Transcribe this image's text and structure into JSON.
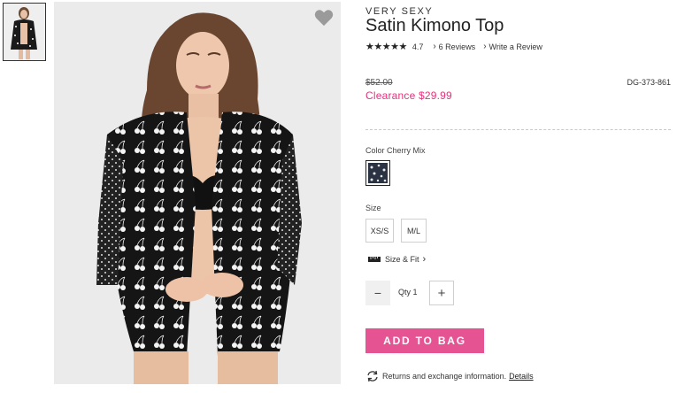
{
  "product": {
    "brand": "VERY SEXY",
    "title": "Satin Kimono Top",
    "rating": {
      "stars_text": "★★★★★",
      "value": "4.7",
      "reviews_label": "6 Reviews",
      "write_review_label": "Write a Review"
    },
    "price": {
      "original": "$52.00",
      "clearance": "Clearance $29.99"
    },
    "sku": "DG-373-861"
  },
  "options": {
    "color_label": "Color Cherry Mix",
    "size_label": "Size",
    "sizes": [
      "XS/S",
      "M/L"
    ],
    "size_fit_label": "Size & Fit"
  },
  "quantity": {
    "minus_symbol": "−",
    "label": "Qty 1",
    "plus_symbol": "+"
  },
  "actions": {
    "add_to_bag_label": "ADD TO BAG"
  },
  "returns": {
    "text": "Returns and exchange information.",
    "details_label": "Details"
  },
  "icons": {
    "wishlist": "heart-icon",
    "chevron": "chevron-right-icon",
    "ruler": "ruler-icon",
    "returns": "exchange-cycle-icon"
  },
  "colors": {
    "accent_pink": "#e65393",
    "clearance_red": "#e2337c",
    "text_dark": "#222222"
  }
}
